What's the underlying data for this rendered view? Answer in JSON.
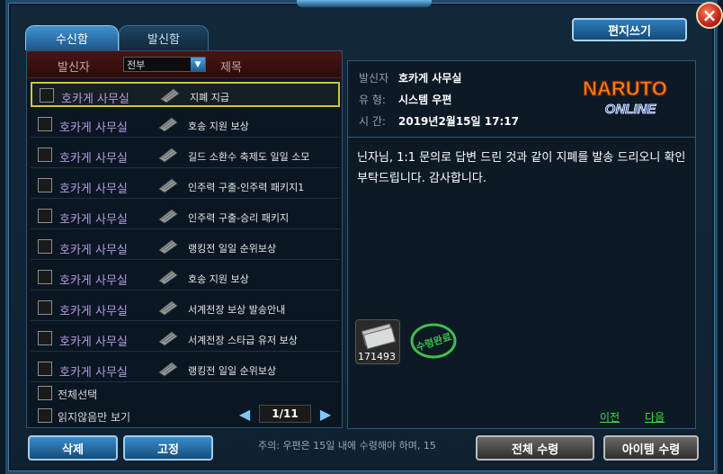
{
  "window": {
    "close_label": "×"
  },
  "tabs": [
    {
      "label": "수신함",
      "active": true
    },
    {
      "label": "발신함",
      "active": false
    }
  ],
  "write_button": "편지쓰기",
  "list": {
    "header_sender": "발신자",
    "filter_value": "전부",
    "header_subject": "제목",
    "rows": [
      {
        "sender": "호카게 사무실",
        "subject": "지폐 지급",
        "selected": true
      },
      {
        "sender": "호카게 사무실",
        "subject": "호송 지원 보상"
      },
      {
        "sender": "호카게 사무실",
        "subject": "길드 소환수 축제도 일일 소모"
      },
      {
        "sender": "호카게 사무실",
        "subject": "인주력 구출-인주력 패키지1"
      },
      {
        "sender": "호카게 사무실",
        "subject": "인주력 구출-승리 패키지"
      },
      {
        "sender": "호카게 사무실",
        "subject": "랭킹전 일일 순위보상"
      },
      {
        "sender": "호카게 사무실",
        "subject": "호송 지원 보상"
      },
      {
        "sender": "호카게 사무실",
        "subject": "서계전장 보상 발송안내"
      },
      {
        "sender": "호카게 사무실",
        "subject": "서계전장 스타급 유저 보상"
      },
      {
        "sender": "호카게 사무실",
        "subject": "랭킹전 일일 순위보상"
      }
    ],
    "select_all": "전체선택",
    "unread_only": "읽지않음만 보기",
    "page": "1/11"
  },
  "detail": {
    "sender_label": "발신자",
    "sender_value": "호카게 사무실",
    "type_label": "유 형:",
    "type_value": "시스템 우편",
    "time_label": "시 간:",
    "time_value": "2019년2월15일 17:17",
    "logo_line1": "NARUTO",
    "logo_line2": "ONLINE",
    "body": "닌자님, 1:1 문의로 답변 드린 것과 같이 지폐를 발송 드리오니 확인 부탁드립니다. 감사합니다.",
    "item_count": "171493",
    "stamp_text": "수령완료",
    "prev": "이전",
    "next": "다음"
  },
  "bottom": {
    "delete": "삭제",
    "pin": "고정",
    "notice": "주의: 우편은 15일 내에 수령해야 하며, 15",
    "receive_all": "전체 수령",
    "receive_item": "아이템 수령"
  },
  "colors": {
    "sender_purple": "#b49be0",
    "selected_border": "#d8c23a",
    "link_green": "#46e042"
  }
}
